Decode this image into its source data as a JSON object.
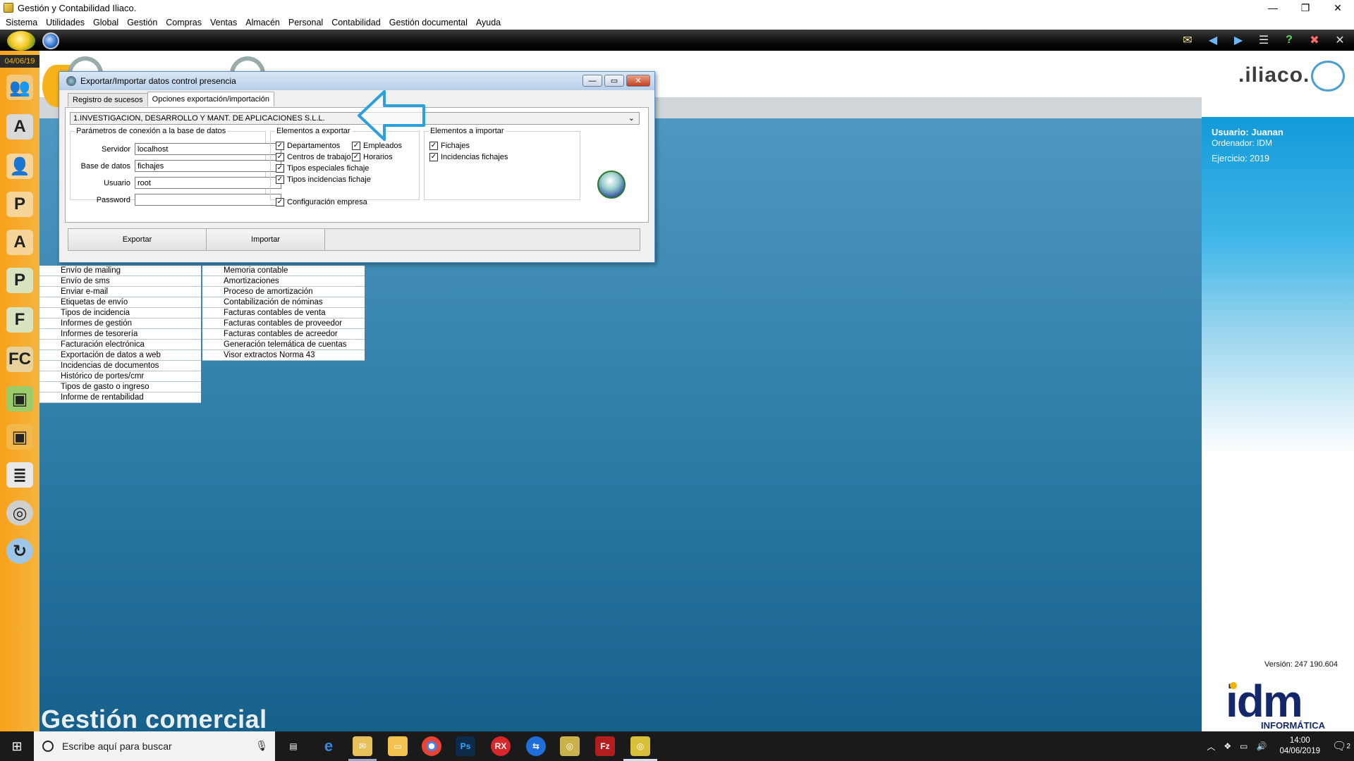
{
  "window": {
    "title": "Gestión y Contabilidad Iliaco.",
    "minimize": "—",
    "restore": "❐",
    "close": "✕"
  },
  "menu": [
    "Sistema",
    "Utilidades",
    "Global",
    "Gestión",
    "Compras",
    "Ventas",
    "Almacén",
    "Personal",
    "Contabilidad",
    "Gestión documental",
    "Ayuda"
  ],
  "sidebar": {
    "date": "04/06/19",
    "icons": [
      "users-group-icon",
      "text-a-icon",
      "user-icon",
      "user-p-icon",
      "user-a-icon",
      "p-icon",
      "f-icon",
      "fc-icon",
      "green-bag-icon",
      "orange-bag-icon",
      "list-icon",
      "disc-icon",
      "sync-icon"
    ]
  },
  "brand": {
    "logo_text": ".iliaco."
  },
  "info": {
    "usuario": "Usuario: Juanan",
    "ordenador": "Ordenador: IDM",
    "ejercicio": "Ejercicio: 2019",
    "version": "Versión: 247 190.604"
  },
  "idm": {
    "logo": "idm",
    "sub": "INFORMÁTICA"
  },
  "lists": {
    "left": [
      "Envío de mailing",
      "Envío de sms",
      "Enviar e-mail",
      "Etiquetas de envío",
      "Tipos de incidencia",
      "Informes de gestión",
      "Informes de tesorería",
      "Facturación electrónica",
      "Exportación de datos a web",
      "Incidencias de documentos",
      "Histórico de portes/cmr",
      "Tipos de gasto o ingreso",
      "Informe de rentabilidad"
    ],
    "right": [
      "Memoria contable",
      "Amortizaciones",
      "Proceso de amortización",
      "Contabilización de nóminas",
      "Facturas contables de venta",
      "Facturas contables de proveedor",
      "Facturas contables de acreedor",
      "Generación telemática de cuentas",
      "Visor extractos Norma 43"
    ]
  },
  "footer_label": "Gestión comercial",
  "dialog": {
    "title": "Exportar/Importar datos control presencia",
    "tabs": [
      "Registro de sucesos",
      "Opciones exportación/importación"
    ],
    "company": "1.INVESTIGACION, DESARROLLO Y MANT. DE APLICACIONES S.L.L.",
    "conn_group": "Parámetros de conexión a la base de datos",
    "fields": {
      "servidor_label": "Servidor",
      "servidor": "localhost",
      "base_label": "Base de datos",
      "base": "fichajes",
      "usuario_label": "Usuario",
      "usuario": "root",
      "password_label": "Password",
      "password": ""
    },
    "export_group": "Elementos a exportar",
    "export_items": {
      "departamentos": "Departamentos",
      "empleados": "Empleados",
      "centros": "Centros de trabajo",
      "horarios": "Horarios",
      "tipos_especiales": "Tipos especiales fichaje",
      "tipos_incidencias": "Tipos incidencias fichaje",
      "configuracion": "Configuración empresa"
    },
    "import_group": "Elementos a importar",
    "import_items": {
      "fichajes": "Fichajes",
      "incidencias": "Incidencias fichajes"
    },
    "buttons": {
      "exportar": "Exportar",
      "importar": "Importar"
    }
  },
  "taskbar": {
    "search_placeholder": "Escribe aquí para buscar",
    "time": "14:00",
    "date": "04/06/2019",
    "notifications": "2"
  }
}
